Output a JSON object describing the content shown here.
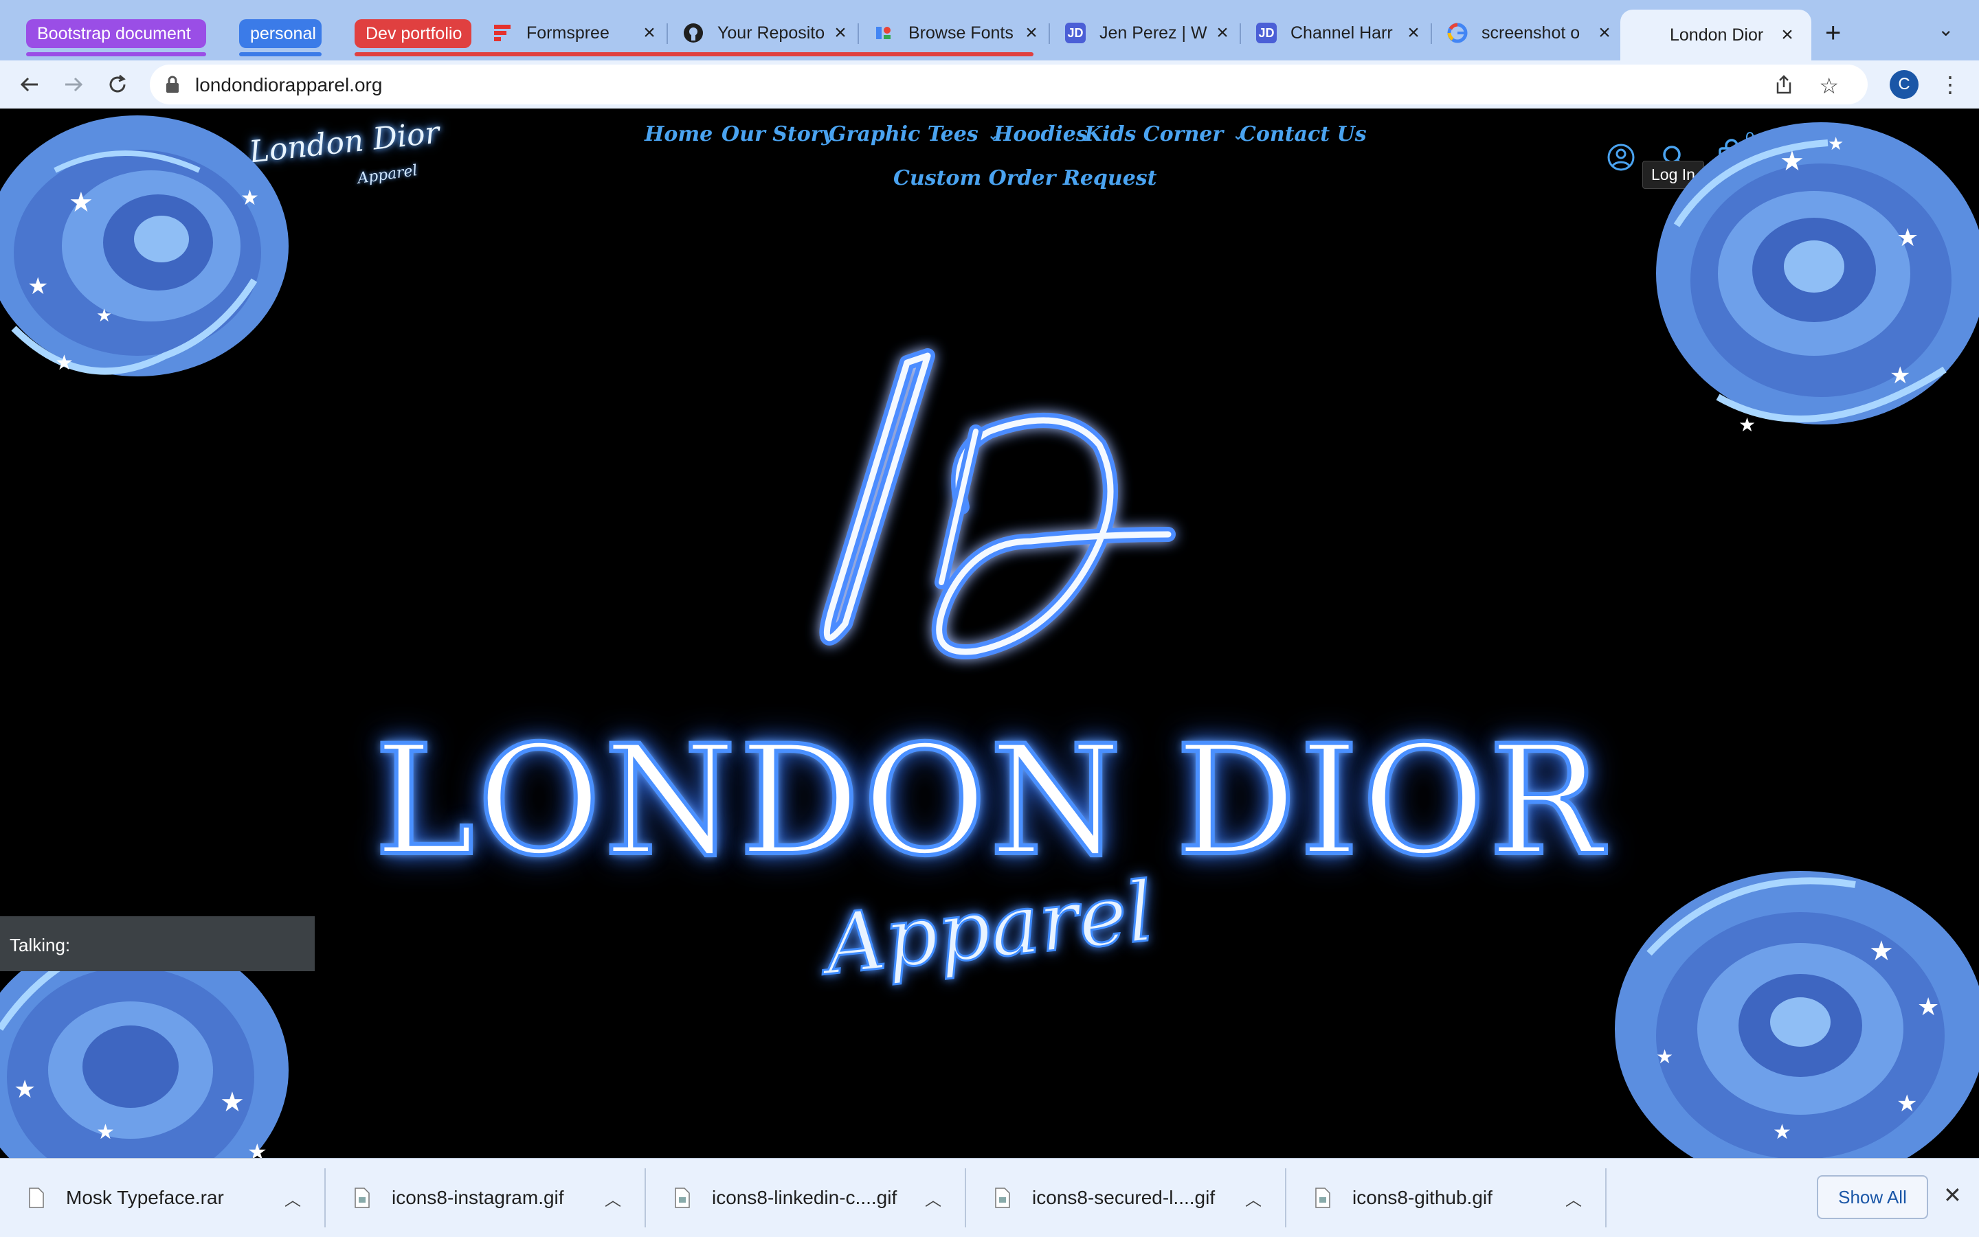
{
  "browser": {
    "tab_groups": [
      {
        "label": "Bootstrap document",
        "color": "#9a4ee6"
      },
      {
        "label": "personal",
        "color": "#3b7be8"
      },
      {
        "label": "Dev portfolio",
        "color": "#e04040"
      }
    ],
    "tabs": [
      {
        "title": "Formspree",
        "favicon": "formspree-icon"
      },
      {
        "title": "Your Reposito",
        "favicon": "github-icon"
      },
      {
        "title": "Browse Fonts",
        "favicon": "google-fonts-icon"
      },
      {
        "title": "Jen Perez | W",
        "favicon": "jd-icon"
      },
      {
        "title": "Channel Harr",
        "favicon": "jd-icon"
      },
      {
        "title": "screenshot o",
        "favicon": "google-icon"
      },
      {
        "title": "London Dior",
        "favicon": "none",
        "active": true
      }
    ],
    "url": "londondiorapparel.org",
    "profile_initial": "C"
  },
  "site": {
    "logo_text": "London Dior",
    "logo_sub": "Apparel",
    "nav": [
      {
        "label": "Home"
      },
      {
        "label": "Our Story"
      },
      {
        "label": "Graphic Tees",
        "dropdown": true
      },
      {
        "label": "Hoodies"
      },
      {
        "label": "Kids Corner",
        "dropdown": true
      },
      {
        "label": "Contact Us"
      },
      {
        "label": "Custom Order Request"
      }
    ],
    "cart_count": "0",
    "tooltip": "Log In",
    "hero": {
      "title": "LONDON DIOR",
      "subtitle": "Apparel"
    },
    "talking_label": "Talking:"
  },
  "downloads": {
    "items": [
      {
        "name": "Mosk Typeface.rar"
      },
      {
        "name": "icons8-instagram.gif"
      },
      {
        "name": "icons8-linkedin-c....gif"
      },
      {
        "name": "icons8-secured-l....gif"
      },
      {
        "name": "icons8-github.gif"
      }
    ],
    "show_all_label": "Show All"
  },
  "colors": {
    "accent": "#4aa3f0",
    "tabstrip": "#aac7f1",
    "toolbar": "#e9f1fd"
  }
}
